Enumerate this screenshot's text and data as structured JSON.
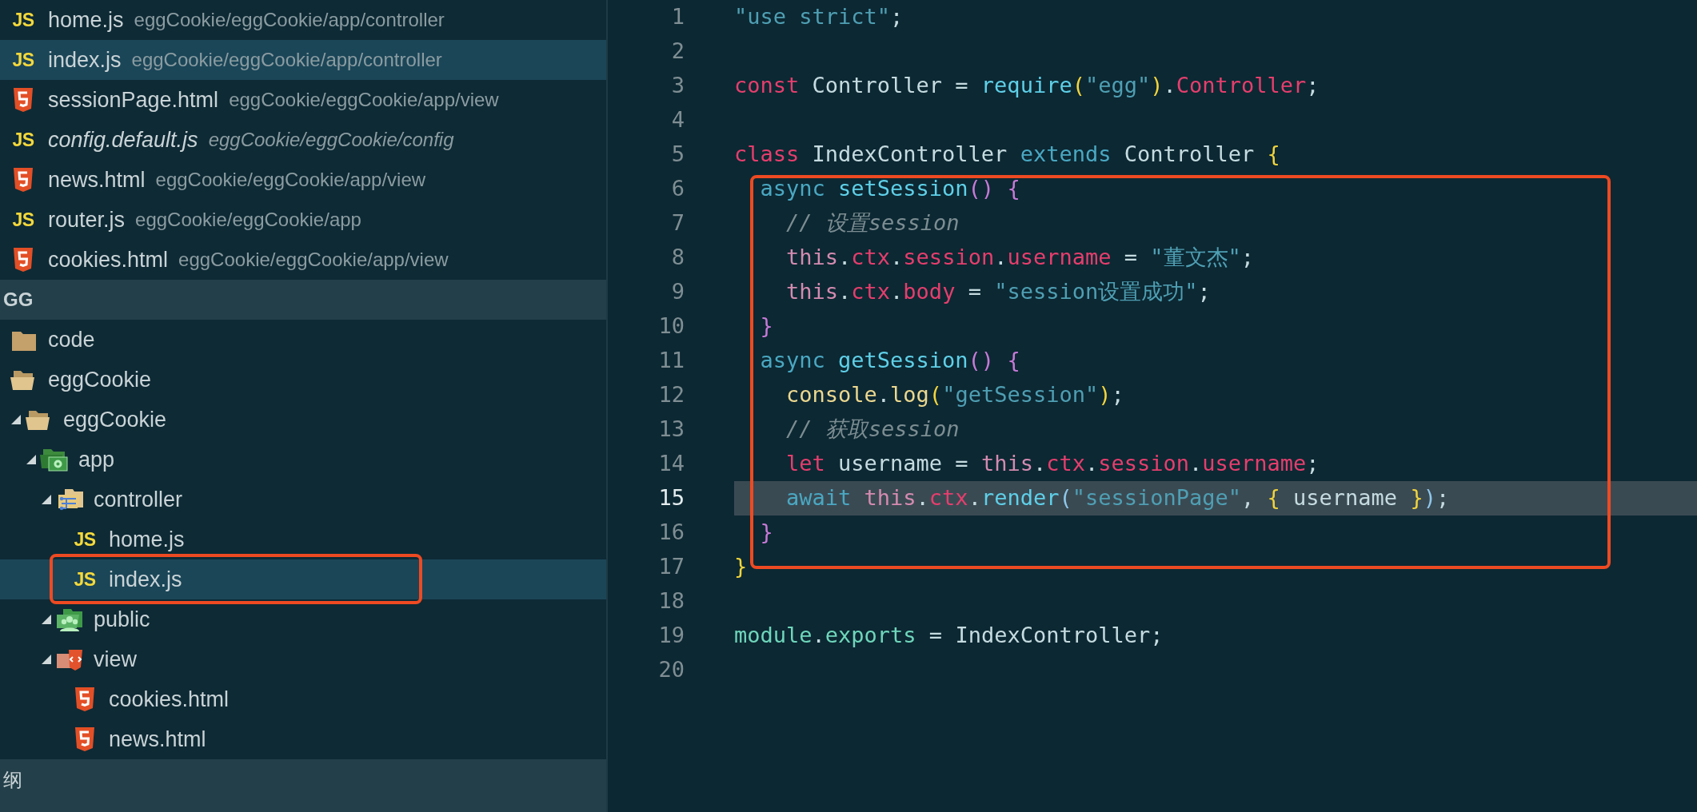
{
  "open_editors": [
    {
      "name": "home.js",
      "path": "eggCookie/eggCookie/app/controller",
      "kind": "js",
      "badge": "JS",
      "selected": false,
      "preview": false
    },
    {
      "name": "index.js",
      "path": "eggCookie/eggCookie/app/controller",
      "kind": "js",
      "badge": "JS",
      "selected": true,
      "preview": false
    },
    {
      "name": "sessionPage.html",
      "path": "eggCookie/eggCookie/app/view",
      "kind": "html",
      "selected": false,
      "preview": false
    },
    {
      "name": "config.default.js",
      "path": "eggCookie/eggCookie/config",
      "kind": "js",
      "badge": "JS",
      "selected": false,
      "preview": true
    },
    {
      "name": "news.html",
      "path": "eggCookie/eggCookie/app/view",
      "kind": "html",
      "selected": false,
      "preview": false
    },
    {
      "name": "router.js",
      "path": "eggCookie/eggCookie/app",
      "kind": "js",
      "badge": "JS",
      "selected": false,
      "preview": false
    },
    {
      "name": "cookies.html",
      "path": "eggCookie/eggCookie/app/view",
      "kind": "html",
      "selected": false,
      "preview": false
    }
  ],
  "section_header": "GG",
  "tree": [
    {
      "name": "code",
      "kind": "folder",
      "expanded": false,
      "selected": false
    },
    {
      "name": "eggCookie",
      "kind": "folder",
      "expanded": true,
      "selected": false,
      "children": [
        {
          "name": "eggCookie",
          "kind": "folder",
          "expanded": true,
          "selected": false,
          "children": [
            {
              "name": "app",
              "kind": "app",
              "expanded": true,
              "selected": false,
              "children": [
                {
                  "name": "controller",
                  "kind": "controller",
                  "expanded": true,
                  "selected": false,
                  "children": [
                    {
                      "name": "home.js",
                      "kind": "js",
                      "badge": "JS",
                      "selected": false
                    },
                    {
                      "name": "index.js",
                      "kind": "js",
                      "badge": "JS",
                      "selected": true
                    }
                  ]
                },
                {
                  "name": "public",
                  "kind": "public",
                  "expanded": true,
                  "selected": false
                },
                {
                  "name": "view",
                  "kind": "view",
                  "expanded": true,
                  "selected": false,
                  "children": [
                    {
                      "name": "cookies.html",
                      "kind": "html",
                      "selected": false
                    },
                    {
                      "name": "news.html",
                      "kind": "html",
                      "selected": false
                    }
                  ]
                }
              ]
            }
          ]
        }
      ]
    }
  ],
  "bottom_header": "纲",
  "code_lines": [
    {
      "number": "1",
      "current": false,
      "tokens": [
        {
          "kind": "str",
          "t": "\"use strict\""
        },
        {
          "kind": "plain",
          "t": ";"
        }
      ]
    },
    {
      "number": "2",
      "current": false
    },
    {
      "number": "3",
      "current": false,
      "tokens": [
        {
          "kind": "kw",
          "t": "const"
        },
        {
          "kind": "plain",
          "t": " Controller = "
        },
        {
          "kind": "fn",
          "t": "require"
        },
        {
          "kind": "yellow",
          "t": "("
        },
        {
          "kind": "str",
          "t": "\"egg\""
        },
        {
          "kind": "yellow",
          "t": ")"
        },
        {
          "kind": "plain",
          "t": "."
        },
        {
          "kind": "prop",
          "t": "Controller"
        },
        {
          "kind": "plain",
          "t": ";"
        }
      ]
    },
    {
      "number": "4",
      "current": false
    },
    {
      "number": "5",
      "current": false,
      "tokens": [
        {
          "kind": "kw",
          "t": "class"
        },
        {
          "kind": "plain",
          "t": " IndexController "
        },
        {
          "kind": "kw2",
          "t": "extends"
        },
        {
          "kind": "plain",
          "t": " Controller "
        },
        {
          "kind": "yellow",
          "t": "{"
        }
      ]
    },
    {
      "number": "6",
      "current": false,
      "tokens": [
        {
          "kind": "kw2",
          "t": "  async"
        },
        {
          "kind": "fn",
          "t": " setSession"
        },
        {
          "kind": "purple",
          "t": "() {"
        }
      ]
    },
    {
      "number": "7",
      "current": false,
      "tokens": [
        {
          "kind": "comment",
          "t": "    // 设置session"
        }
      ]
    },
    {
      "number": "8",
      "current": false,
      "tokens": [
        {
          "kind": "this",
          "t": "    this"
        },
        {
          "kind": "plain",
          "t": "."
        },
        {
          "kind": "prop",
          "t": "ctx"
        },
        {
          "kind": "plain",
          "t": "."
        },
        {
          "kind": "prop",
          "t": "session"
        },
        {
          "kind": "plain",
          "t": "."
        },
        {
          "kind": "prop",
          "t": "username"
        },
        {
          "kind": "plain",
          "t": " = "
        },
        {
          "kind": "str",
          "t": "\"董文杰\""
        },
        {
          "kind": "plain",
          "t": ";"
        }
      ]
    },
    {
      "number": "9",
      "current": false,
      "tokens": [
        {
          "kind": "this",
          "t": "    this"
        },
        {
          "kind": "plain",
          "t": "."
        },
        {
          "kind": "prop",
          "t": "ctx"
        },
        {
          "kind": "plain",
          "t": "."
        },
        {
          "kind": "prop",
          "t": "body"
        },
        {
          "kind": "plain",
          "t": " = "
        },
        {
          "kind": "str",
          "t": "\"session设置成功\""
        },
        {
          "kind": "plain",
          "t": ";"
        }
      ]
    },
    {
      "number": "10",
      "current": false,
      "tokens": [
        {
          "kind": "purple",
          "t": "  }"
        }
      ]
    },
    {
      "number": "11",
      "current": false,
      "tokens": [
        {
          "kind": "kw2",
          "t": "  async"
        },
        {
          "kind": "fn",
          "t": " getSession"
        },
        {
          "kind": "purple",
          "t": "() {"
        }
      ]
    },
    {
      "number": "12",
      "current": false,
      "tokens": [
        {
          "kind": "console",
          "t": "    console"
        },
        {
          "kind": "plain",
          "t": "."
        },
        {
          "kind": "console",
          "t": "log"
        },
        {
          "kind": "yellow",
          "t": "("
        },
        {
          "kind": "str",
          "t": "\"getSession\""
        },
        {
          "kind": "yellow",
          "t": ")"
        },
        {
          "kind": "plain",
          "t": ";"
        }
      ]
    },
    {
      "number": "13",
      "current": false,
      "tokens": [
        {
          "kind": "comment",
          "t": "    // 获取session"
        }
      ]
    },
    {
      "number": "14",
      "current": false,
      "tokens": [
        {
          "kind": "kw",
          "t": "    let"
        },
        {
          "kind": "plain",
          "t": " username = "
        },
        {
          "kind": "this",
          "t": "this"
        },
        {
          "kind": "plain",
          "t": "."
        },
        {
          "kind": "prop",
          "t": "ctx"
        },
        {
          "kind": "plain",
          "t": "."
        },
        {
          "kind": "prop",
          "t": "session"
        },
        {
          "kind": "plain",
          "t": "."
        },
        {
          "kind": "prop",
          "t": "username"
        },
        {
          "kind": "plain",
          "t": ";"
        }
      ]
    },
    {
      "number": "15",
      "current": true,
      "tokens": [
        {
          "kind": "kw2",
          "t": "    await"
        },
        {
          "kind": "this",
          "t": " this"
        },
        {
          "kind": "plain",
          "t": "."
        },
        {
          "kind": "prop",
          "t": "ctx"
        },
        {
          "kind": "plain",
          "t": "."
        },
        {
          "kind": "fn",
          "t": "render"
        },
        {
          "kind": "blue",
          "t": "("
        },
        {
          "kind": "str",
          "t": "\"sessionPage\""
        },
        {
          "kind": "plain",
          "t": ", "
        },
        {
          "kind": "yellow",
          "t": "{"
        },
        {
          "kind": "plain",
          "t": " username "
        },
        {
          "kind": "yellow",
          "t": "}"
        },
        {
          "kind": "blue",
          "t": ")"
        },
        {
          "kind": "plain",
          "t": ";"
        }
      ]
    },
    {
      "number": "16",
      "current": false,
      "tokens": [
        {
          "kind": "purple",
          "t": "  }"
        }
      ]
    },
    {
      "number": "17",
      "current": false,
      "tokens": [
        {
          "kind": "yellow",
          "t": "}"
        }
      ]
    },
    {
      "number": "18",
      "current": false
    },
    {
      "number": "19",
      "current": false,
      "tokens": [
        {
          "kind": "module",
          "t": "module"
        },
        {
          "kind": "plain",
          "t": "."
        },
        {
          "kind": "module",
          "t": "exports"
        },
        {
          "kind": "plain",
          "t": " = IndexController;"
        }
      ]
    },
    {
      "number": "20",
      "current": false
    }
  ]
}
